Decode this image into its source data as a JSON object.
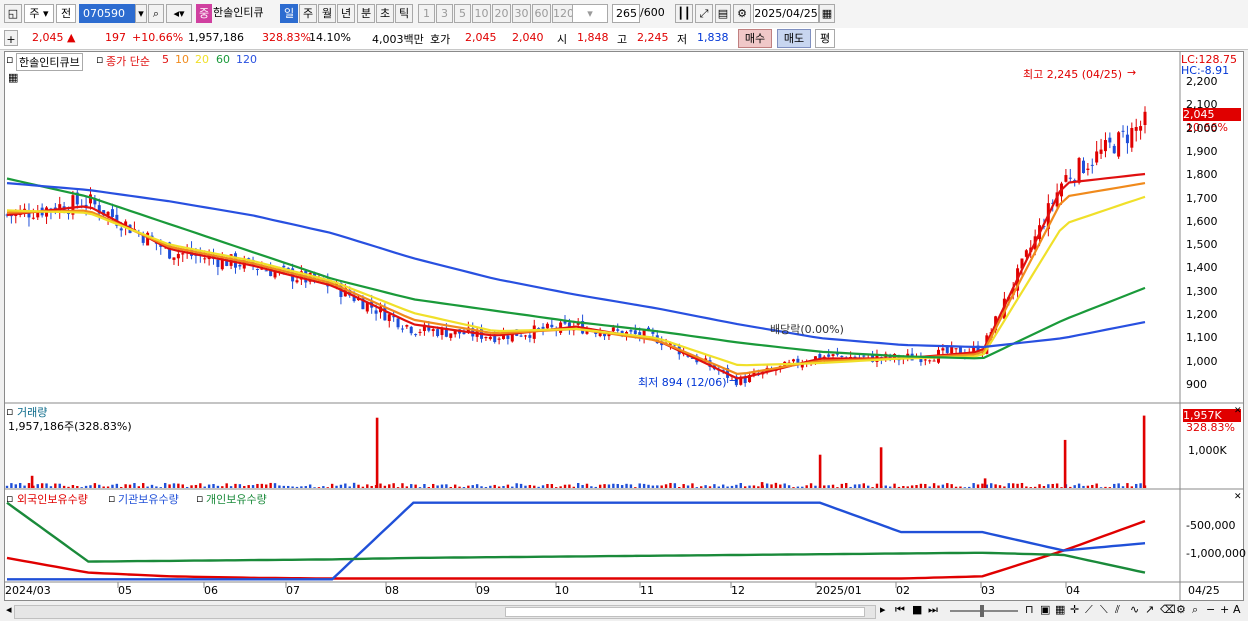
{
  "toolbar": {
    "period_unit": "주",
    "prev_label": "전",
    "code": "070590",
    "badge": "중",
    "stock_name": "한솔인티큐",
    "periods": [
      "일",
      "주",
      "월",
      "년",
      "분",
      "초",
      "틱"
    ],
    "active_period": "일",
    "intervals": [
      "1",
      "3",
      "5",
      "10",
      "20",
      "30",
      "60",
      "120"
    ],
    "count": "265",
    "count_total": "/600",
    "date": "2025/04/25"
  },
  "quote": {
    "price": "2,045",
    "change": "197",
    "change_rate": "+10.66%",
    "volume": "1,957,186",
    "volume_ratio": "328.83%",
    "turnover": "14.10%",
    "amount": "4,003백만",
    "ask_label": "호가",
    "ask": "2,045",
    "bid": "2,040",
    "open_label": "시",
    "open": "1,848",
    "high_label": "고",
    "high": "2,245",
    "low_label": "저",
    "low": "1,838",
    "buy_label": "매수",
    "sell_label": "매도",
    "avg_label": "평"
  },
  "price_pane": {
    "title": "한솔인티큐브",
    "ma_label": "종가 단순",
    "ma_periods": [
      "5",
      "10",
      "20",
      "60",
      "120"
    ],
    "ma_colors": [
      "#e01010",
      "#f08a1c",
      "#f0e02a",
      "#1a9a3a",
      "#2850e0"
    ],
    "lc": "LC:128.75",
    "hc": "HC:-8.91",
    "max_annotation": "최고 2,245 (04/25)",
    "min_annotation": "최저 894 (12/06)",
    "dividend_annotation": "배당락(0.00%)",
    "current_price_tag": "2,045",
    "current_rate_tag": "10.66%",
    "y_ticks": [
      "2,200",
      "2,100",
      "2,000",
      "1,900",
      "1,800",
      "1,700",
      "1,600",
      "1,500",
      "1,400",
      "1,300",
      "1,200",
      "1,100",
      "1,000",
      "900"
    ]
  },
  "volume_pane": {
    "title": "거래량",
    "value": "1,957,186주(328.83%)",
    "tag": "1,957K",
    "tag_rate": "328.83%",
    "y_ticks": [
      "1,000K"
    ]
  },
  "holding_pane": {
    "series": [
      "외국인보유수량",
      "기관보유수량",
      "개인보유수량"
    ],
    "series_colors": [
      "#e00000",
      "#2050d8",
      "#1a8a3a"
    ],
    "y_ticks": [
      "-500,000",
      "-1,000,000"
    ]
  },
  "x_axis": {
    "ticks": [
      "2024/03",
      "05",
      "06",
      "07",
      "08",
      "09",
      "10",
      "11",
      "12",
      "2025/01",
      "02",
      "03",
      "04"
    ],
    "right_label": "04/25"
  },
  "chart_data": [
    {
      "type": "candlestick",
      "x": [
        "2024/03",
        "2024/04",
        "2024/05",
        "2024/06",
        "2024/07",
        "2024/08",
        "2024/09",
        "2024/10",
        "2024/11",
        "2024/12",
        "2025/01",
        "2025/02",
        "2025/03",
        "2025/04",
        "2025/04/25"
      ],
      "close": [
        1640,
        1700,
        1480,
        1420,
        1330,
        1140,
        1110,
        1150,
        1100,
        910,
        1020,
        1010,
        1050,
        1800,
        2045
      ],
      "y_range": [
        850,
        2250
      ],
      "series": [
        {
          "name": "5",
          "values": [
            1640,
            1680,
            1490,
            1420,
            1330,
            1160,
            1110,
            1150,
            1090,
            920,
            1010,
            1010,
            1040,
            1780,
            1820
          ]
        },
        {
          "name": "10",
          "values": [
            1650,
            1660,
            1500,
            1430,
            1340,
            1180,
            1120,
            1140,
            1090,
            940,
            1000,
            1010,
            1030,
            1720,
            1780
          ]
        },
        {
          "name": "20",
          "values": [
            1660,
            1650,
            1510,
            1440,
            1350,
            1210,
            1130,
            1140,
            1100,
            980,
            990,
            1010,
            1020,
            1600,
            1720
          ]
        },
        {
          "name": "60",
          "values": [
            1800,
            1720,
            1600,
            1480,
            1360,
            1270,
            1220,
            1170,
            1130,
            1080,
            1040,
            1020,
            1010,
            1180,
            1320
          ]
        },
        {
          "name": "120",
          "values": [
            1780,
            1750,
            1700,
            1640,
            1560,
            1450,
            1360,
            1290,
            1230,
            1160,
            1100,
            1070,
            1060,
            1100,
            1170
          ]
        }
      ]
    },
    {
      "type": "bar",
      "title": "거래량",
      "x": [
        "2024/03",
        "2024/08",
        "2024/12",
        "2025/01",
        "2025/02",
        "2025/03",
        "2025/04",
        "2025/04/25"
      ],
      "values": [
        330,
        1900,
        160,
        900,
        1100,
        260,
        1300,
        1957
      ],
      "unit": "K"
    },
    {
      "type": "line",
      "series": [
        {
          "name": "외국인보유수량",
          "values": [
            -1000000,
            -1200000,
            -1250000,
            -1270000,
            -1280000,
            -1280000,
            -1280000,
            -1280000,
            -1280000,
            -1280000,
            -1280000,
            -1280000,
            -1250000,
            -900000,
            -500000
          ]
        },
        {
          "name": "기관보유수량",
          "values": [
            -1290000,
            -1290000,
            -1290000,
            -1290000,
            -1290000,
            -250000,
            -250000,
            -250000,
            -250000,
            -250000,
            -250000,
            -650000,
            -650000,
            -900000,
            -800000
          ]
        },
        {
          "name": "개인보유수량",
          "values": [
            -250000,
            -1050000,
            -1040000,
            -1030000,
            -1020000,
            -1000000,
            -990000,
            -980000,
            -970000,
            -960000,
            -950000,
            -940000,
            -930000,
            -960000,
            -1200000
          ]
        }
      ]
    }
  ]
}
